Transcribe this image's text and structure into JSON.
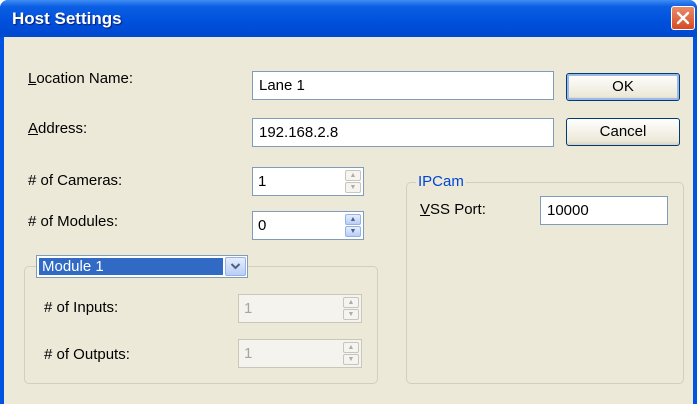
{
  "window": {
    "title": "Host Settings"
  },
  "form": {
    "location_label_underlined": "L",
    "location_label_rest": "ocation Name:",
    "location_value": "Lane 1",
    "address_label_underlined": "A",
    "address_label_rest": "ddress:",
    "address_value": "192.168.2.8",
    "cameras_label": "# of Cameras:",
    "cameras_value": "1",
    "modules_label": "# of Modules:",
    "modules_value": "0"
  },
  "buttons": {
    "ok": "OK",
    "cancel": "Cancel"
  },
  "module_group": {
    "selected": "Module 1",
    "inputs_label": "# of Inputs:",
    "inputs_value": "1",
    "outputs_label": "# of Outputs:",
    "outputs_value": "1"
  },
  "ipcam_group": {
    "title": "IPCam",
    "vss_label_underlined": "V",
    "vss_label_rest": "SS Port:",
    "vss_value": "10000"
  },
  "icons": {
    "close": "close-x-icon",
    "spin_up": "spin-up-arrow-icon",
    "spin_down": "spin-down-arrow-icon",
    "dropdown": "chevron-down-icon"
  },
  "colors": {
    "titlebar": "#0053e1",
    "client": "#ece9d8",
    "group_title": "#0046d5",
    "selection": "#316ac5",
    "close_button": "#d64a22"
  }
}
